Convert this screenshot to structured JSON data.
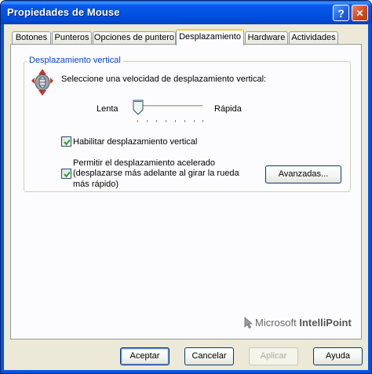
{
  "window": {
    "title": "Propiedades de Mouse",
    "help_label": "?",
    "close_label": "✕"
  },
  "tabs": [
    {
      "label": "Botones",
      "active": false
    },
    {
      "label": "Punteros",
      "active": false
    },
    {
      "label": "Opciones de puntero",
      "active": false
    },
    {
      "label": "Desplazamiento",
      "active": true
    },
    {
      "label": "Hardware",
      "active": false
    },
    {
      "label": "Actividades",
      "active": false
    }
  ],
  "vertical_scroll": {
    "legend": "Desplazamiento vertical",
    "icon": "scroll-wheel-icon",
    "speed_prompt": "Seleccione una velocidad de desplazamiento vertical:",
    "slider_min_label": "Lenta",
    "slider_max_label": "Rápida",
    "slider_fraction": 0.0,
    "enable_label": "Habilitar desplazamiento vertical",
    "enable_checked": true,
    "accel_line1": "Permitir el desplazamiento acelerado",
    "accel_line2": "(desplazarse más adelante al girar la rueda",
    "accel_line3": "más rápido)",
    "accel_checked": true,
    "advanced_button": "Avanzadas..."
  },
  "branding": {
    "prefix": "Microsoft",
    "product": "IntelliPoint"
  },
  "footer": {
    "ok": "Aceptar",
    "cancel": "Cancelar",
    "apply": "Aplicar",
    "help": "Ayuda"
  },
  "colors": {
    "titlebar": "#0054e3",
    "legend_text": "#0046d5",
    "checkmark": "#21a121",
    "active_tab_highlight": "#ffc83c"
  }
}
